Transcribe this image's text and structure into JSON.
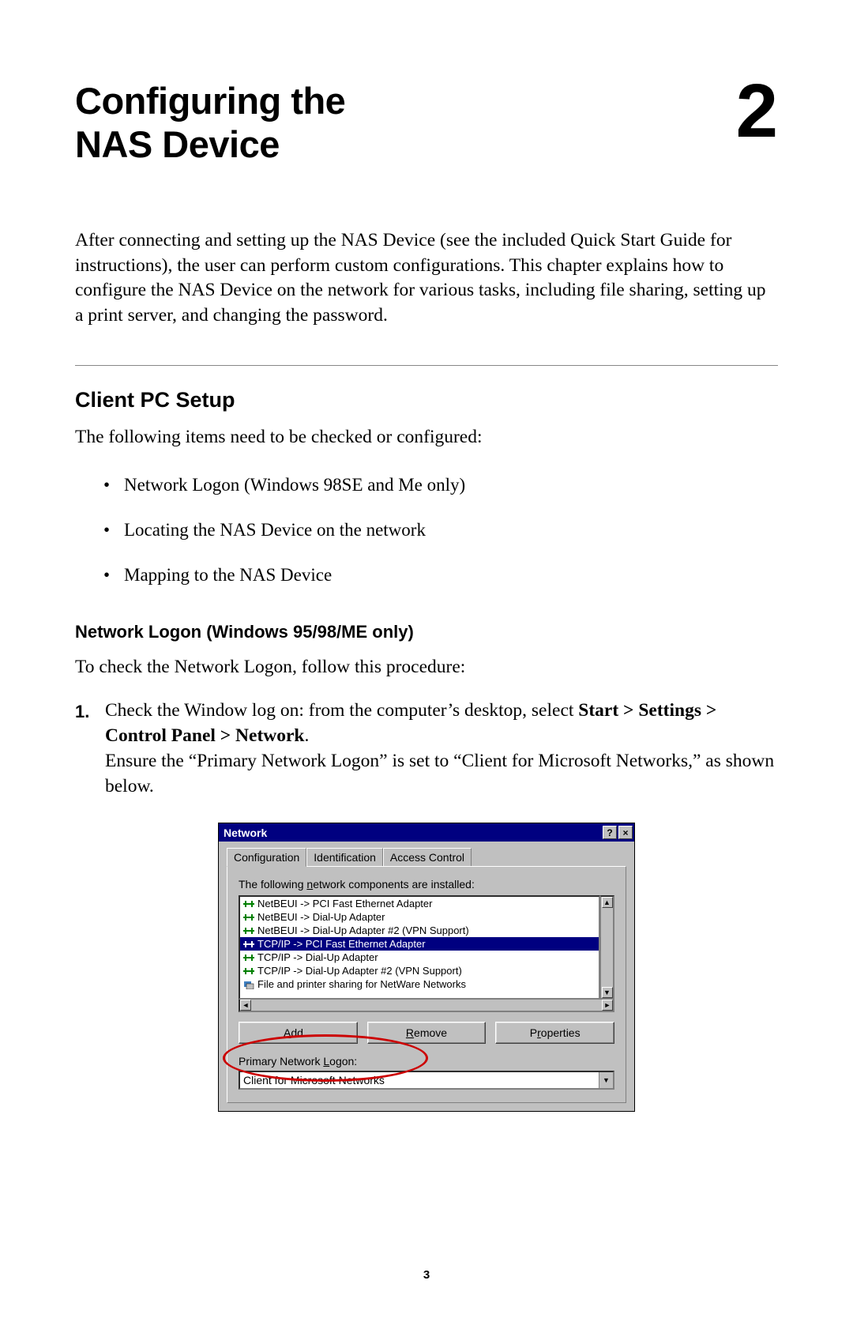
{
  "chapter": {
    "title": "Configuring the NAS Device",
    "number": "2"
  },
  "intro": "After connecting and setting up the NAS Device (see the included Quick Start Guide for instructions), the user can perform custom configurations. This chapter explains how to configure the NAS Device on the network for various tasks, including file sharing, setting up a print server, and changing the password.",
  "section": {
    "heading": "Client PC Setup",
    "lead": "The following items need to be checked or configured:"
  },
  "bullets": [
    "Network Logon (Windows 98SE and Me only)",
    "Locating the NAS Device on the network",
    "Mapping to the NAS Device"
  ],
  "subsection": {
    "heading": "Network Logon (Windows 95/98/ME only)",
    "lead": "To check the Network Logon, follow this procedure:"
  },
  "step1": {
    "num": "1.",
    "l1a": "Check the Window log on: from the computer’s desktop, select ",
    "l1b": "Start > Settings > Control Panel > Network",
    "l1c": ".",
    "l2": "Ensure the “Primary Network Logon” is set to “Client for Microsoft Networks,” as shown below."
  },
  "dialog": {
    "title": "Network",
    "help": "?",
    "close": "×",
    "tabs": {
      "config": "Configuration",
      "ident": "Identification",
      "access": "Access Control"
    },
    "components_label_pre": "The following ",
    "components_label_u": "n",
    "components_label_post": "etwork components are installed:",
    "rows": [
      "NetBEUI -> PCI Fast Ethernet Adapter",
      "NetBEUI -> Dial-Up Adapter",
      "NetBEUI -> Dial-Up Adapter #2 (VPN Support)",
      "TCP/IP -> PCI Fast Ethernet Adapter",
      "TCP/IP -> Dial-Up Adapter",
      "TCP/IP -> Dial-Up Adapter #2 (VPN Support)",
      "File and printer sharing for NetWare Networks"
    ],
    "selected_index": 3,
    "buttons": {
      "add": "Add...",
      "add_u": "A",
      "remove": "Remove",
      "remove_u": "R",
      "props": "Properties",
      "props_u": "r"
    },
    "pnl_label_pre": "Primary Network ",
    "pnl_label_u": "L",
    "pnl_label_post": "ogon:",
    "pnl_value": "Client for Microsoft Networks"
  },
  "page_number": "3"
}
